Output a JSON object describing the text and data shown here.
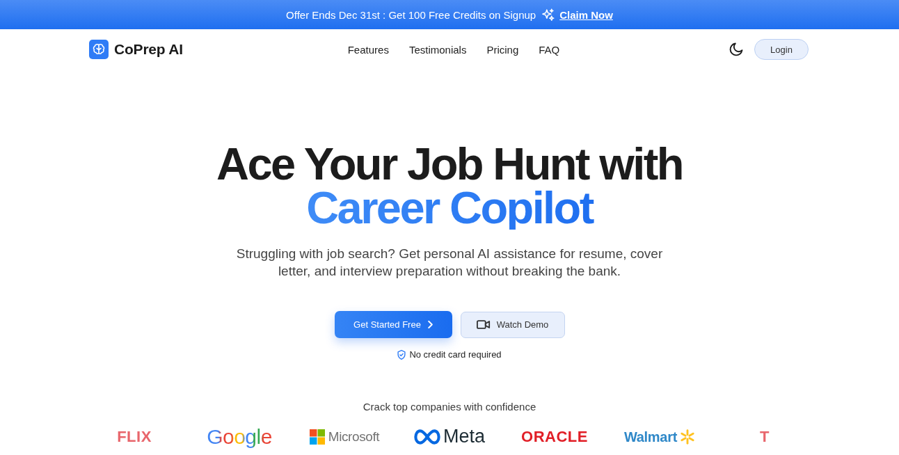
{
  "banner": {
    "text": "Offer Ends Dec 31st : Get 100 Free Credits on Signup",
    "link": "Claim Now"
  },
  "nav": {
    "brand": "CoPrep AI",
    "links": [
      {
        "label": "Features"
      },
      {
        "label": "Testimonials"
      },
      {
        "label": "Pricing"
      },
      {
        "label": "FAQ"
      }
    ],
    "login": "Login"
  },
  "hero": {
    "title_lines": [
      {
        "text": "Ace Your Job Hunt with",
        "kind": "plain"
      },
      {
        "text": "Career Copilot",
        "kind": "accent"
      }
    ],
    "subtitle": "Struggling with job search? Get personal AI assistance for resume, cover letter, and interview preparation without breaking the bank.",
    "buttons": [
      {
        "label": "Get Started Free",
        "kind": "primary"
      },
      {
        "label": "Watch Demo",
        "kind": "secondary"
      }
    ],
    "note": "No credit card required"
  },
  "companies": {
    "heading": "Crack top companies with confidence",
    "logos": [
      {
        "name": "FLIX",
        "kind": "wordmark",
        "color": "#e8666c"
      },
      {
        "name": "Google",
        "kind": "multicolor"
      },
      {
        "name": "Microsoft",
        "kind": "squares",
        "color": "#737373"
      },
      {
        "name": "Meta",
        "kind": "loop",
        "color": "#1c2b33"
      },
      {
        "name": "ORACLE",
        "kind": "wordmark",
        "color": "#e11e26"
      },
      {
        "name": "Walmart",
        "kind": "spark",
        "color": "#2f88c8"
      },
      {
        "name": "T",
        "kind": "wordmark",
        "color": "#e8666c"
      }
    ]
  }
}
